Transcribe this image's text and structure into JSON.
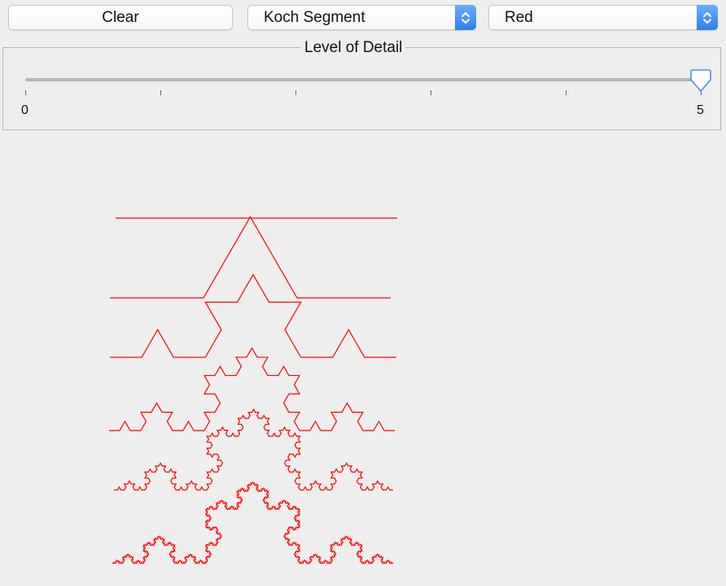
{
  "toolbar": {
    "clear_label": "Clear",
    "shape_select": {
      "selected": "Koch Segment"
    },
    "color_select": {
      "selected": "Red"
    }
  },
  "detail_panel": {
    "title": "Level of Detail",
    "slider": {
      "min": 0,
      "max": 5,
      "value": 5,
      "tick_count": 6
    },
    "min_label": "0",
    "max_label": "5"
  },
  "icons": {
    "select_arrow": "up-down-chevron-icon",
    "slider_thumb": "slider-thumb-icon"
  },
  "colors": {
    "stroke": "#ff0000",
    "accent": "#3b8ff5"
  },
  "drawing": {
    "shape": "koch-segment",
    "levels": [
      0,
      1,
      2,
      3,
      4,
      5
    ]
  }
}
